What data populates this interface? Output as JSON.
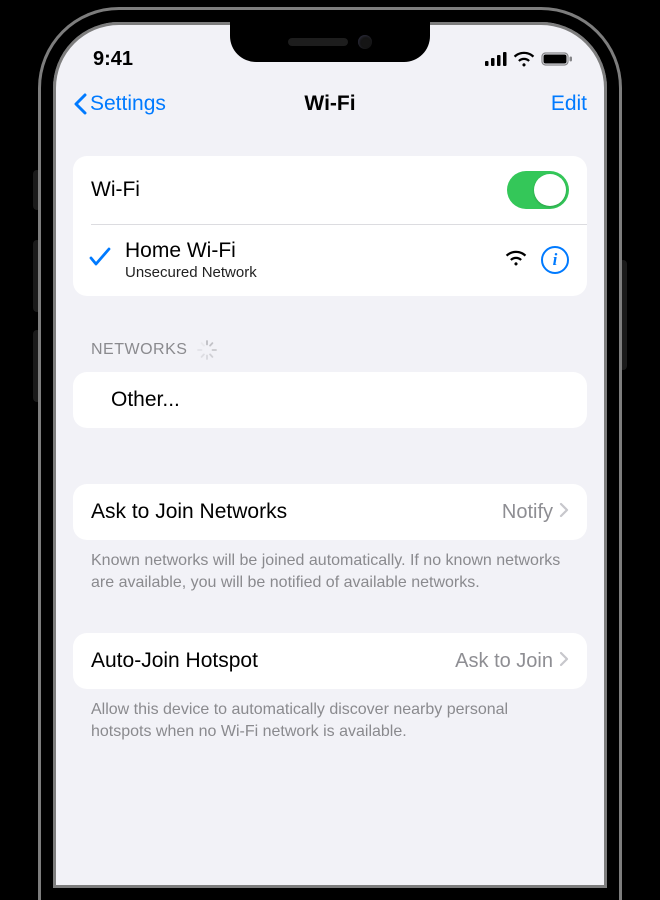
{
  "status": {
    "time": "9:41"
  },
  "nav": {
    "back": "Settings",
    "title": "Wi-Fi",
    "edit": "Edit"
  },
  "wifi": {
    "toggle_label": "Wi-Fi",
    "connected": {
      "name": "Home Wi-Fi",
      "subtitle": "Unsecured Network"
    }
  },
  "sections": {
    "networks_header": "NETWORKS",
    "other_label": "Other..."
  },
  "ask_join": {
    "label": "Ask to Join Networks",
    "value": "Notify",
    "footer": "Known networks will be joined automatically. If no known networks are available, you will be notified of available networks."
  },
  "auto_join": {
    "label": "Auto-Join Hotspot",
    "value": "Ask to Join",
    "footer": "Allow this device to automatically discover nearby personal hotspots when no Wi-Fi network is available."
  }
}
